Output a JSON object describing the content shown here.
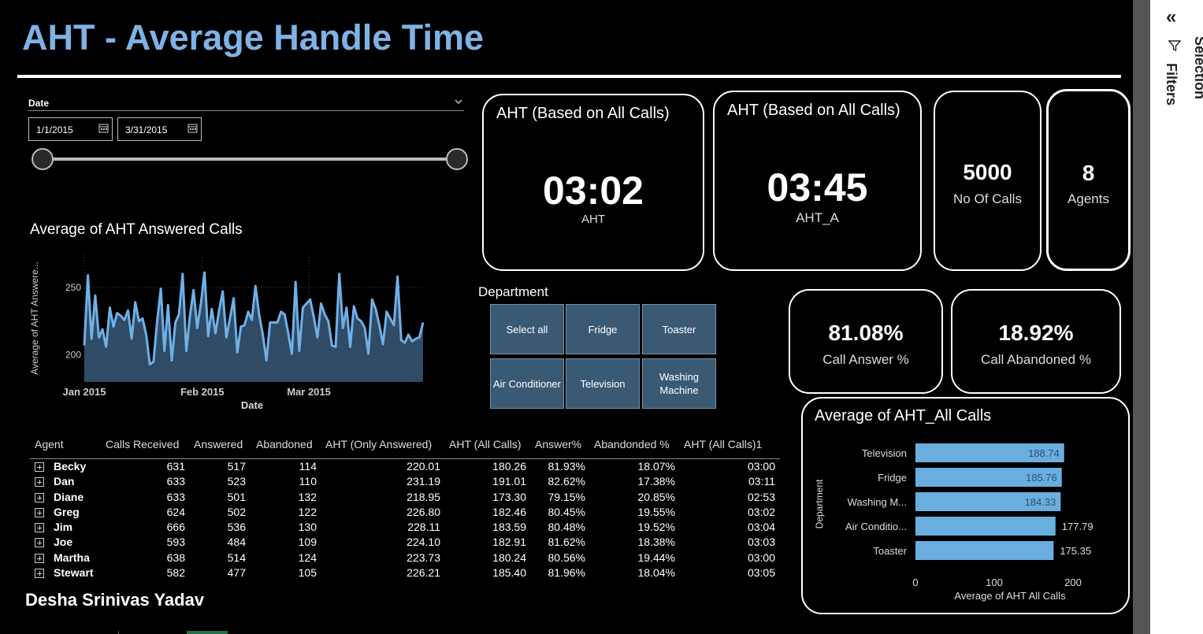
{
  "page": {
    "title": "AHT - Average Handle Time",
    "author": "Desha Srinivas Yadav"
  },
  "filters_pane": {
    "label": "Filters",
    "selection_label": "Selection",
    "collapse_icon": "double-chevron-left-icon"
  },
  "date_slicer": {
    "label": "Date",
    "start": "1/1/2015",
    "end": "3/31/2015"
  },
  "kpis": {
    "aht_all": {
      "heading": "AHT (Based on All Calls)",
      "value": "03:02",
      "label": "AHT"
    },
    "aht_a": {
      "heading": "AHT (Based on All Calls)",
      "value": "03:45",
      "label": "AHT_A"
    },
    "calls": {
      "value": "5000",
      "label": "No Of Calls"
    },
    "agents": {
      "value": "8",
      "label": "Agents"
    },
    "answer_pct": {
      "value": "81.08%",
      "label": "Call Answer %"
    },
    "abandon_pct": {
      "value": "18.92%",
      "label": "Call Abandoned %"
    }
  },
  "department_slicer": {
    "label": "Department",
    "options": [
      "Select all",
      "Fridge",
      "Toaster",
      "Air Conditioner",
      "Television",
      "Washing Machine"
    ]
  },
  "table": {
    "headers": [
      "Agent",
      "Calls Received",
      "Answered",
      "Abandoned",
      "AHT (Only Answered)",
      "AHT (All Calls)",
      "Answer%",
      "Abandonded %",
      "AHT (All Calls)1"
    ],
    "rows": [
      [
        "Becky",
        "631",
        "517",
        "114",
        "220.01",
        "180.26",
        "81.93%",
        "18.07%",
        "03:00"
      ],
      [
        "Dan",
        "633",
        "523",
        "110",
        "231.19",
        "191.01",
        "82.62%",
        "17.38%",
        "03:11"
      ],
      [
        "Diane",
        "633",
        "501",
        "132",
        "218.95",
        "173.30",
        "79.15%",
        "20.85%",
        "02:53"
      ],
      [
        "Greg",
        "624",
        "502",
        "122",
        "226.80",
        "182.46",
        "80.45%",
        "19.55%",
        "03:02"
      ],
      [
        "Jim",
        "666",
        "536",
        "130",
        "228.11",
        "183.59",
        "80.48%",
        "19.52%",
        "03:04"
      ],
      [
        "Joe",
        "593",
        "484",
        "109",
        "224.10",
        "182.91",
        "81.62%",
        "18.38%",
        "03:03"
      ],
      [
        "Martha",
        "638",
        "514",
        "124",
        "223.73",
        "180.24",
        "80.56%",
        "19.44%",
        "03:00"
      ],
      [
        "Stewart",
        "582",
        "477",
        "105",
        "226.21",
        "185.40",
        "81.96%",
        "18.04%",
        "03:05"
      ]
    ]
  },
  "colors": {
    "accent": "#7fb2e5",
    "line": "#6fb0e8",
    "area": "#2f4b66",
    "bar": "#6aaee0",
    "slicer_button": "#3a5a74"
  },
  "chart_data": [
    {
      "type": "area",
      "title": "Average of AHT Answered Calls",
      "xlabel": "Date",
      "ylabel": "Average of AHT Answere...",
      "x_ticks": [
        "Jan 2015",
        "Feb 2015",
        "Mar 2015"
      ],
      "y_ticks": [
        200,
        250
      ],
      "ylim": [
        180,
        275
      ],
      "x_range": [
        "2015-01-01",
        "2015-03-31"
      ],
      "grid": true,
      "values": [
        207,
        259,
        212,
        244,
        213,
        219,
        206,
        235,
        221,
        231,
        229,
        226,
        233,
        212,
        239,
        225,
        227,
        215,
        193,
        195,
        225,
        249,
        203,
        237,
        196,
        224,
        230,
        260,
        203,
        229,
        248,
        220,
        238,
        261,
        214,
        234,
        216,
        233,
        247,
        213,
        227,
        242,
        202,
        221,
        222,
        232,
        226,
        251,
        230,
        215,
        196,
        224,
        224,
        224,
        232,
        230,
        216,
        201,
        254,
        203,
        235,
        238,
        241,
        228,
        213,
        238,
        230,
        225,
        207,
        206,
        260,
        220,
        235,
        206,
        236,
        227,
        225,
        220,
        201,
        241,
        234,
        222,
        208,
        232,
        227,
        222,
        258,
        211,
        209,
        215,
        210,
        212,
        213,
        224
      ]
    },
    {
      "type": "bar",
      "orientation": "horizontal",
      "title": "Average of AHT_All Calls",
      "xlabel": "Average of AHT  All Calls",
      "ylabel": "Department",
      "categories": [
        "Television",
        "Fridge",
        "Washing M...",
        "Air Conditio...",
        "Toaster"
      ],
      "values": [
        188.74,
        185.76,
        184.33,
        177.79,
        175.35
      ],
      "x_ticks": [
        0,
        100,
        200
      ],
      "xlim": [
        0,
        210
      ]
    }
  ]
}
